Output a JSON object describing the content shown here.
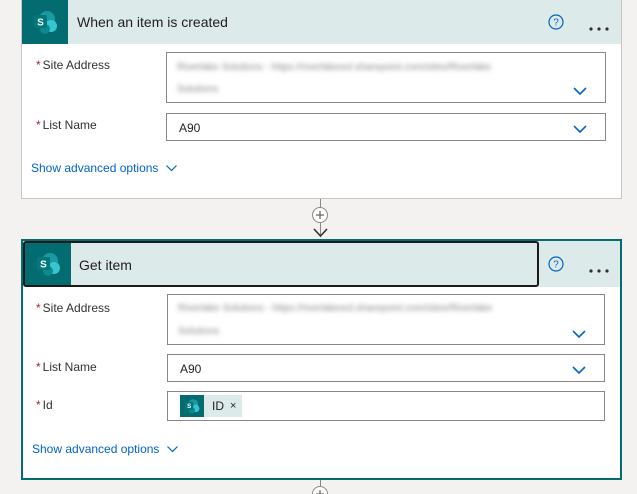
{
  "trigger": {
    "title": "When an item is created",
    "site_address_label": "Site Address",
    "site_address_blurred_line1": "Riverlake Solutions - https://riverlakesol.sharepoint.com/sites/Riverlake",
    "site_address_blurred_line2": "Solutions",
    "list_name_label": "List Name",
    "list_name_value": "A90",
    "advanced_options_label": "Show advanced options",
    "required_marker": "*"
  },
  "action": {
    "title": "Get item",
    "site_address_label": "Site Address",
    "site_address_blurred_line1": "Riverlake Solutions - https://riverlakesol.sharepoint.com/sites/Riverlake",
    "site_address_blurred_line2": "Solutions",
    "list_name_label": "List Name",
    "list_name_value": "A90",
    "id_label": "Id",
    "id_token_label": "ID",
    "id_token_remove": "×",
    "advanced_options_label": "Show advanced options",
    "required_marker": "*"
  },
  "colors": {
    "sharepoint_teal": "#036c70",
    "header_bg": "#ddeaea",
    "link_blue": "#0064c8",
    "required_red": "#a4262c"
  },
  "icons": {
    "app": "sharepoint-icon",
    "help": "help-circle-icon",
    "more": "more-ellipsis-icon",
    "dropdown": "chevron-down-icon",
    "insert": "plus-icon"
  }
}
